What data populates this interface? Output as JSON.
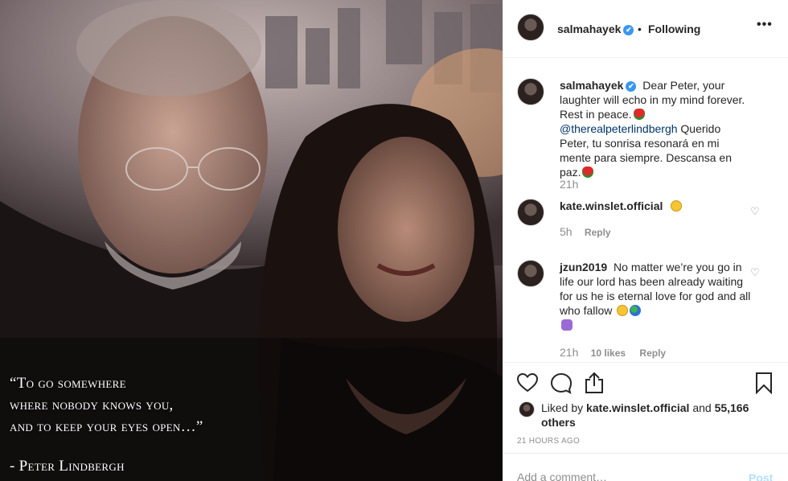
{
  "photo": {
    "quote_lines": [
      "“To go somewhere",
      "where nobody knows you,",
      "and to keep your eyes open…”"
    ],
    "attribution": "- Peter Lindbergh"
  },
  "header": {
    "username": "salmahayek",
    "separator": "•",
    "follow_status": "Following",
    "more": "•••"
  },
  "caption": {
    "username": "salmahayek",
    "text_1": "Dear Peter, your laughter will echo in my mind forever. Rest in peace.",
    "mention": "@therealpeterlindbergh",
    "text_2": "Querido Peter, tu sonrisa resonará en mi mente para siempre. Descansa en paz.",
    "time": "21h"
  },
  "comments": [
    {
      "username": "kate.winslet.official",
      "text": "",
      "time": "5h",
      "likes": "",
      "reply": "Reply"
    },
    {
      "username": "jzun2019",
      "text": "No matter we’re you go in life our lord has been already waiting for us he is eternal love for god and all who fallow",
      "time": "21h",
      "likes": "10 likes",
      "reply": "Reply"
    }
  ],
  "actions": {
    "liked_by_prefix": "Liked by",
    "liked_by_user": "kate.winslet.official",
    "liked_by_and": "and",
    "others": "55,166 others",
    "timestamp": "21 hours ago"
  },
  "add_comment": {
    "placeholder": "Add a comment…",
    "post": "Post"
  },
  "icons": {
    "verified": "✔",
    "comment_like": "♡"
  },
  "colors": {
    "accent_blue": "#3897f0",
    "mention": "#003569",
    "muted": "#8e8e8e",
    "post_disabled": "#b2dffc"
  }
}
